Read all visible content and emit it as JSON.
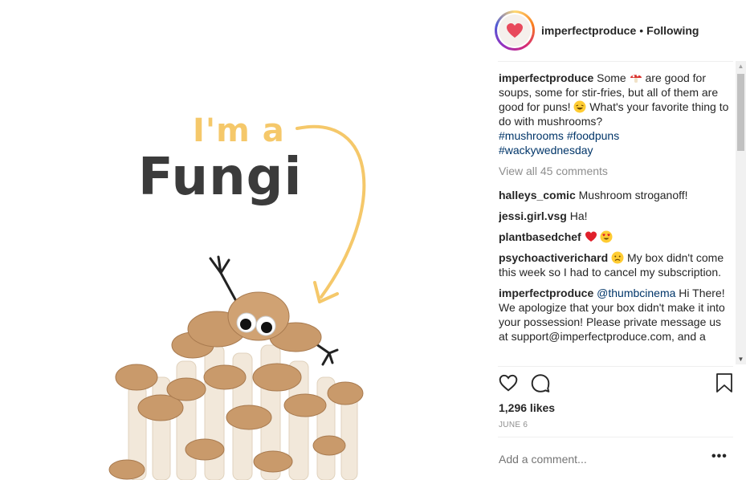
{
  "post": {
    "image_text_line1": "I'm a",
    "image_text_line2": "Fungi"
  },
  "header": {
    "username": "imperfectproduce",
    "separator": "•",
    "follow_status": "Following"
  },
  "caption": {
    "username": "imperfectproduce",
    "text_part1": "Some",
    "text_part2": "are good for soups, some for stir-fries, but all of them are good for puns!",
    "text_part3": "What's your favorite thing to do with mushrooms?",
    "hashtag1": "#mushrooms",
    "hashtag2": "#foodpuns",
    "hashtag3": "#wackywednesday"
  },
  "view_all_comments": "View all 45 comments",
  "comments": [
    {
      "username": "halleys_comic",
      "text": "Mushroom stroganoff!"
    },
    {
      "username": "jessi.girl.vsg",
      "text": "Ha!"
    },
    {
      "username": "plantbasedchef",
      "text": ""
    },
    {
      "username": "psychoactiverichard",
      "text": "My box didn't come this week so I had to cancel my subscription."
    },
    {
      "username": "imperfectproduce",
      "mention": "@thumbcinema",
      "text": "Hi There! We apologize that your box didn't make it into your possession! Please private message us at support@imperfectproduce.com, and a"
    }
  ],
  "likes": "1,296 likes",
  "date": "JUNE 6",
  "add_comment_placeholder": "Add a comment...",
  "more_options": "•••",
  "icons": {
    "like": "heart-icon",
    "comment": "comment-bubble-icon",
    "save": "bookmark-icon"
  },
  "colors": {
    "hashtag": "#003569",
    "muted": "#8e8e8e",
    "accent_yellow": "#f5c86a"
  }
}
